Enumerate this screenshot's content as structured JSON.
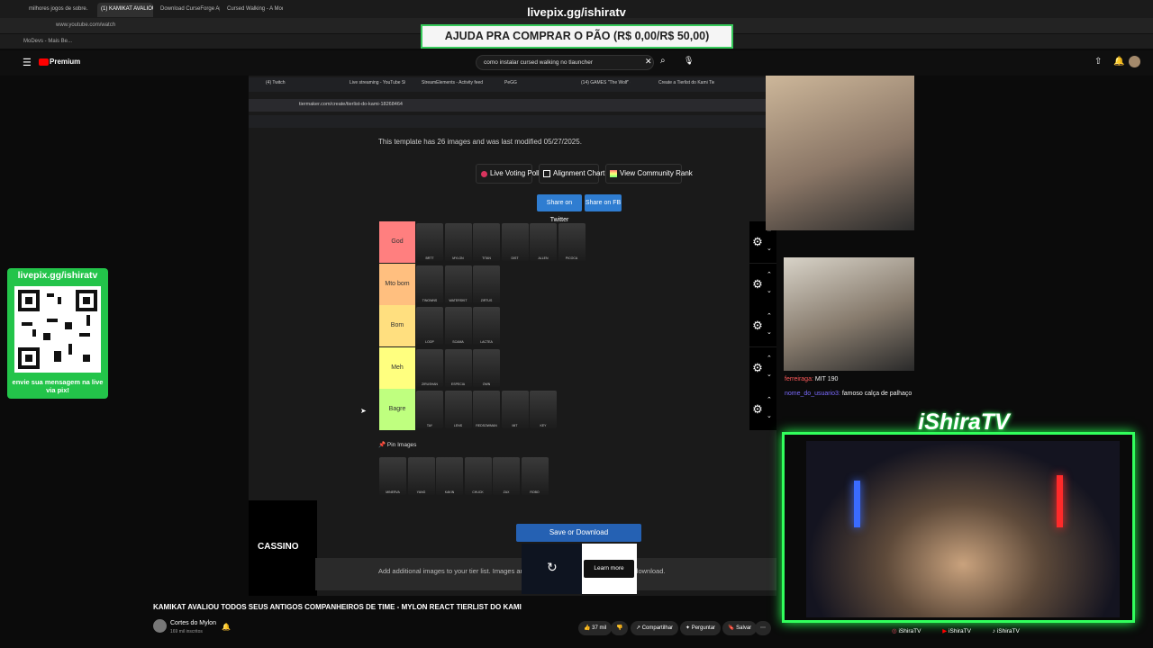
{
  "browser": {
    "tabs": [
      "milhores jogos de sobre...",
      "(1) KAMIKAT AVALIOU",
      "Download CurseForge Ap...",
      "Cursed Walking - A Moder..."
    ],
    "url": "www.youtube.com/watch",
    "bookmark": "MoDevs - Mais Be..."
  },
  "overlay": {
    "title": "livepix.gg/ishiratv",
    "goal": "AJUDA PRA COMPRAR O PÃO (R$ 0,00/R$ 50,00)"
  },
  "youtube": {
    "logo": "Premium",
    "search": "como instalar cursed walking no tlauncher",
    "video_title": "KAMIKAT AVALIOU TODOS SEUS ANTIGOS COMPANHEIROS DE TIME - MYLON REACT TIERLIST DO KAMI",
    "channel": "Cortes do Mylon",
    "subs": "169 mil inscritos",
    "likes": "37 mil",
    "share": "Compartilhar",
    "ask": "Perguntar",
    "save": "Salvar"
  },
  "inner": {
    "tabs": [
      "(4) Twitch",
      "Live streaming - YouTube Stu...",
      "StreamElements - Activity feed",
      "PeGG",
      "(14) GAMES \"The Wolf\" (Dr...",
      "Create a Tierlist do Kami Tier Li..."
    ],
    "url": "tiermaker.com/create/tierlist-do-kami-18268464",
    "template_info": "This template has 26 images and was last modified 05/27/2025.",
    "buttons": [
      "Live Voting Poll",
      "Alignment Chart",
      "View Community Rank"
    ],
    "share_twitter": "Share on Twitter",
    "share_fb": "Share on FB",
    "tiers": [
      {
        "label": "God",
        "color": "#ff7f7f",
        "names": [
          "BRTT",
          "MYLON",
          "TITAN",
          "DIST",
          "ALLEN",
          "PICOCA"
        ]
      },
      {
        "label": "Mto bom",
        "color": "#ffbf7f",
        "names": [
          "TINOWNS",
          "WATERSKIT",
          "ZIRTUS"
        ]
      },
      {
        "label": "Bom",
        "color": "#ffdf7f",
        "names": [
          "LOOP",
          "SCAMA",
          "LACTEA"
        ]
      },
      {
        "label": "Meh",
        "color": "#ffff7f",
        "names": [
          "ZIRUSHAN",
          "ESPECIA",
          "OWN"
        ]
      },
      {
        "label": "Bagre",
        "color": "#bfff7f",
        "names": [
          "TAY",
          "LENS",
          "REDSOWMAN",
          "MIT",
          "KEY"
        ]
      }
    ],
    "pin_label": "Pin Images",
    "pin_names": [
      "MINERVA",
      "YANG",
      "KAKIN",
      "CHUCK",
      "ZAX",
      "ROBO"
    ],
    "save_download": "Save or Download",
    "add_text": "Add additional images to your tier list. Images are",
    "add_text_tail": "ed in your download.",
    "learn_more": "Learn more",
    "casino": "CASSINO"
  },
  "chat": {
    "user1": "ferreiraga:",
    "msg1": "MIT 190",
    "user2": "nome_do_usuario3:",
    "msg2": "famoso calça de palhaço"
  },
  "stream": {
    "brand": "iShiraTV",
    "socials": [
      "iShiraTV",
      "iShiraTV",
      "iShiraTV"
    ]
  },
  "qr": {
    "title": "livepix.gg/ishiratv",
    "caption": "envie sua mensagem na live via pix!"
  }
}
